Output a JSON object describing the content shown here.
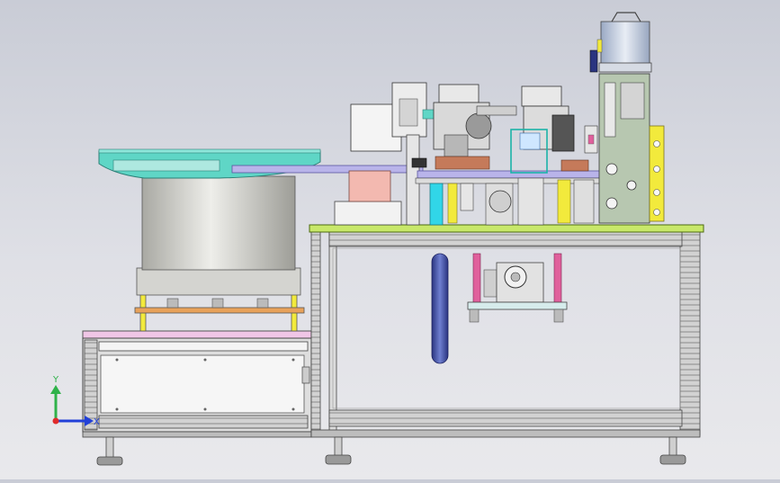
{
  "viewport": {
    "background_top": "#c9ccd6",
    "background_bottom": "#e9e9ec"
  },
  "triad": {
    "y_label": "Y",
    "x_label": "X",
    "y_color": "#2fb24a",
    "x_color": "#2140d8",
    "z_color": "#e02b2b"
  },
  "colors": {
    "frame_aluminum": "#c8c8c8",
    "plate_green": "#c8e86a",
    "bowl_teal": "#5fd6c6",
    "bowl_body": "#d8d8d0",
    "pink_panel": "#f0c6e6",
    "cyan_cylinder": "#31d6e8",
    "yellow_part": "#f2ea3c",
    "navy_cylinder": "#3c4ba8",
    "magenta_rod": "#e0609c",
    "orange_plate": "#e8a25a"
  }
}
